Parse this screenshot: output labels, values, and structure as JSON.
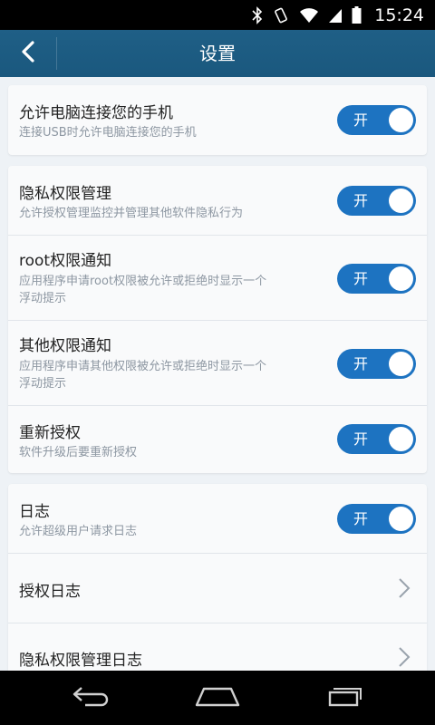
{
  "status_bar": {
    "time": "15:24",
    "icons": [
      "bluetooth-icon",
      "vibrate-icon",
      "wifi-icon",
      "signal-icon",
      "battery-icon"
    ]
  },
  "header": {
    "title": "设置",
    "back_icon": "back-arrow-icon"
  },
  "sections": [
    {
      "rows": [
        {
          "title": "允许电脑连接您的手机",
          "desc": "连接USB时允许电脑连接您的手机",
          "toggle": "开"
        }
      ]
    },
    {
      "rows": [
        {
          "title": "隐私权限管理",
          "desc": "允许授权管理监控并管理其他软件隐私行为",
          "toggle": "开"
        },
        {
          "title": "root权限通知",
          "desc_lines": [
            "应用程序申请root权限被允许或拒绝时显示一个",
            "浮动提示"
          ],
          "toggle": "开"
        },
        {
          "title": "其他权限通知",
          "desc_lines": [
            "应用程序申请其他权限被允许或拒绝时显示一个",
            "浮动提示"
          ],
          "toggle": "开"
        },
        {
          "title": "重新授权",
          "desc": "软件升级后要重新授权",
          "toggle": "开"
        }
      ]
    },
    {
      "rows": [
        {
          "title": "日志",
          "desc": "允许超级用户请求日志",
          "toggle": "开"
        },
        {
          "title": "授权日志",
          "icon": "chevron-right-icon"
        },
        {
          "title": "隐私权限管理日志",
          "icon": "chevron-right-icon"
        }
      ]
    }
  ],
  "colors": {
    "header": "#1a587e",
    "toggle_on": "#1d73c1",
    "background": "#eef2f6"
  }
}
